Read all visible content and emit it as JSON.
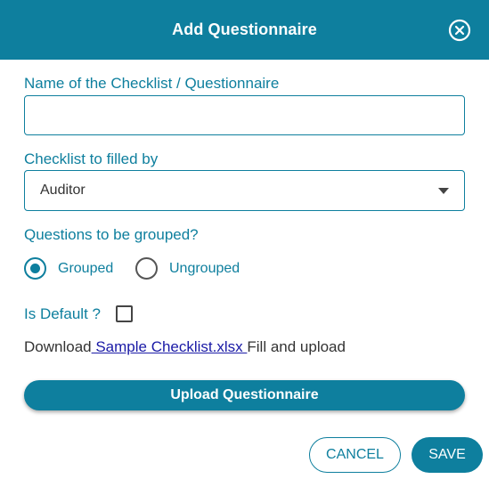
{
  "dialog": {
    "title": "Add Questionnaire",
    "close_icon": "close-circle-icon"
  },
  "name_field": {
    "label": "Name of the Checklist / Questionnaire",
    "value": "",
    "placeholder": ""
  },
  "filled_by_field": {
    "label": "Checklist to filled by",
    "selected_value": "Auditor",
    "arrow_icon": "dropdown-arrow-icon"
  },
  "grouping": {
    "label": "Questions to be grouped?",
    "options": [
      {
        "label": "Grouped",
        "checked": true
      },
      {
        "label": "Ungrouped",
        "checked": false
      }
    ]
  },
  "is_default": {
    "label": "Is Default ?",
    "checked": false
  },
  "download": {
    "prefix": "Download",
    "link_text": " Sample Checklist.xlsx ",
    "suffix": "Fill and upload"
  },
  "buttons": {
    "upload": "Upload Questionnaire",
    "cancel": "CANCEL",
    "save": "SAVE"
  },
  "colors": {
    "primary": "#0e7f9e",
    "link": "#1a1aa6",
    "text": "#333333"
  }
}
